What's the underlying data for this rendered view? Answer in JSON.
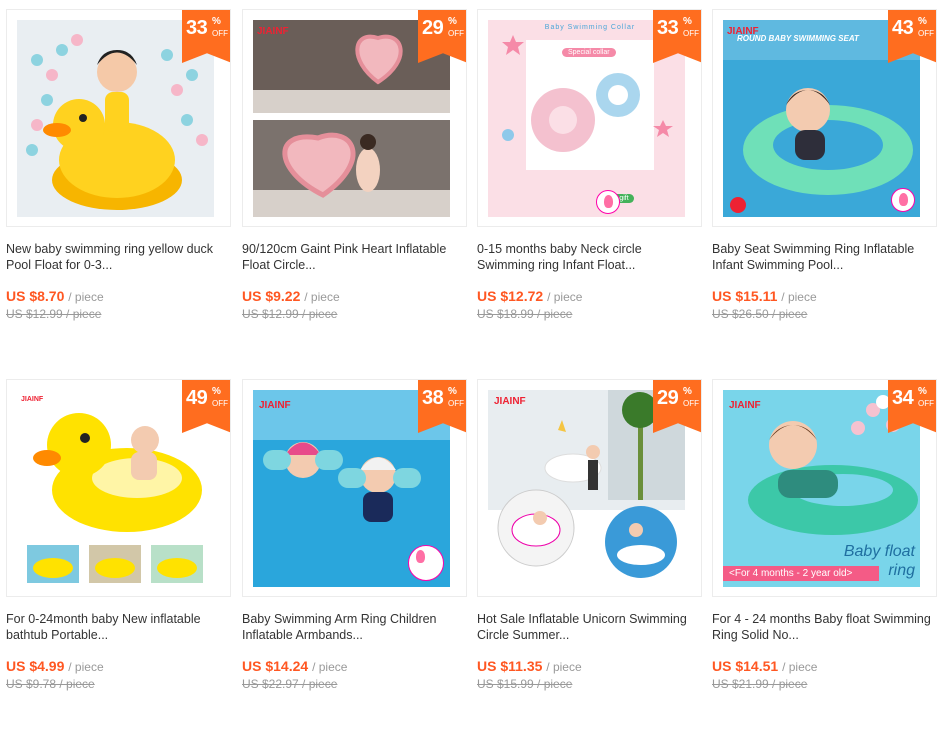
{
  "products": [
    {
      "discount": "33",
      "title": "New baby swimming ring yellow duck Pool Float for 0-3...",
      "price": "US $8.70",
      "unit": "/ piece",
      "original": "US $12.99 / piece"
    },
    {
      "discount": "29",
      "title": "90/120cm Gaint Pink Heart Inflatable Float Circle...",
      "price": "US $9.22",
      "unit": "/ piece",
      "original": "US $12.99 / piece",
      "logo": "JIAINF"
    },
    {
      "discount": "33",
      "title": "0-15 months baby Neck circle Swimming ring Infant Float...",
      "price": "US $12.72",
      "unit": "/ piece",
      "original": "US $18.99 / piece",
      "banner": "Baby  Swimming  Collar",
      "collar": "Special collar",
      "gift": "Free gift"
    },
    {
      "discount": "43",
      "title": "Baby Seat Swimming Ring Inflatable Infant Swimming Pool...",
      "price": "US $15.11",
      "unit": "/ piece",
      "original": "US $26.50 / piece",
      "logo": "JIAINF",
      "img_text": "ROUND BABY SWIMMING SEAT"
    },
    {
      "discount": "49",
      "title": "For 0-24month baby New inflatable bathtub Portable...",
      "price": "US $4.99",
      "unit": "/ piece",
      "original": "US $9.78 / piece",
      "logo": "JIAINF"
    },
    {
      "discount": "38",
      "title": "Baby Swimming Arm Ring Children Inflatable Armbands...",
      "price": "US $14.24",
      "unit": "/ piece",
      "original": "US $22.97 / piece",
      "logo": "JIAINF"
    },
    {
      "discount": "29",
      "title": "Hot Sale Inflatable Unicorn Swimming Circle Summer...",
      "price": "US $11.35",
      "unit": "/ piece",
      "original": "US $15.99 / piece",
      "logo": "JIAINF"
    },
    {
      "discount": "34",
      "title": "For 4 - 24 months Baby float Swimming Ring Solid No...",
      "price": "US $14.51",
      "unit": "/ piece",
      "original": "US $21.99 / piece",
      "logo": "JIAINF",
      "img_text": "Baby float ring",
      "img_note": "<For  4 months - 2 year old>"
    }
  ],
  "badge": {
    "pct": "%",
    "off": "OFF"
  },
  "colors": {
    "accent": "#ff6d1f",
    "price": "#ff5722"
  }
}
